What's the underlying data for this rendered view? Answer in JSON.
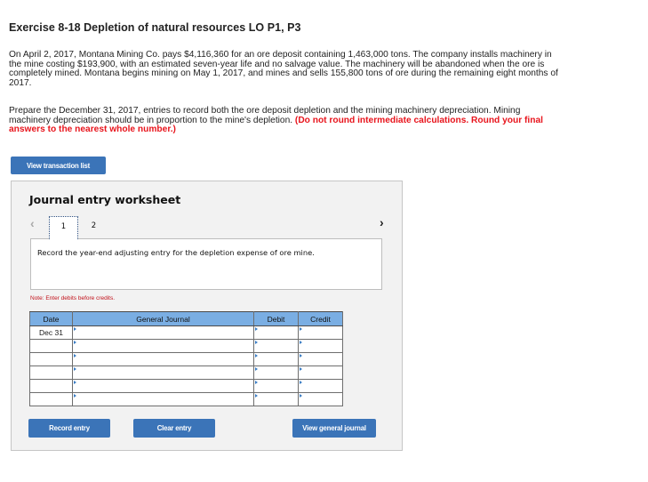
{
  "exercise": {
    "title": "Exercise 8-18 Depletion of natural resources LO P1, P3"
  },
  "problem": {
    "paragraph1": "On April 2, 2017, Montana Mining Co. pays $4,116,360 for an ore deposit containing 1,463,000 tons. The company installs machinery in the mine costing $193,900, with an estimated seven-year life and no salvage value. The machinery will be abandoned when the ore is completely mined. Montana begins mining on May 1, 2017, and mines and sells 155,800 tons of ore during the remaining eight months of 2017.",
    "paragraph2_plain": "Prepare the December 31, 2017, entries to record both the ore deposit depletion and the mining machinery depreciation. Mining machinery depreciation should be in proportion to the mine's depletion. ",
    "paragraph2_red": "(Do not round intermediate calculations. Round your final answers to the nearest whole number.)"
  },
  "buttons": {
    "view_transaction_list": "View transaction list",
    "record_entry": "Record entry",
    "clear_entry": "Clear entry",
    "view_general_journal": "View general journal"
  },
  "worksheet": {
    "title": "Journal entry worksheet",
    "nav_prev_icon": "‹",
    "nav_next_icon": "›",
    "tabs": [
      {
        "label": "1",
        "active": true
      },
      {
        "label": "2",
        "active": false
      }
    ],
    "instruction": "Record the year-end adjusting entry for the depletion expense of ore mine.",
    "note": "Note: Enter debits before credits.",
    "table": {
      "headers": [
        "Date",
        "General Journal",
        "Debit",
        "Credit"
      ],
      "rows": [
        {
          "date": "Dec 31",
          "account": "",
          "debit": "",
          "credit": ""
        },
        {
          "date": "",
          "account": "",
          "debit": "",
          "credit": ""
        },
        {
          "date": "",
          "account": "",
          "debit": "",
          "credit": ""
        },
        {
          "date": "",
          "account": "",
          "debit": "",
          "credit": ""
        },
        {
          "date": "",
          "account": "",
          "debit": "",
          "credit": ""
        },
        {
          "date": "",
          "account": "",
          "debit": "",
          "credit": ""
        }
      ]
    }
  },
  "colors": {
    "button_blue": "#3b74b8",
    "header_blue": "#7aaee3",
    "instruction_red": "#e8141c",
    "note_red": "#c2111a"
  }
}
